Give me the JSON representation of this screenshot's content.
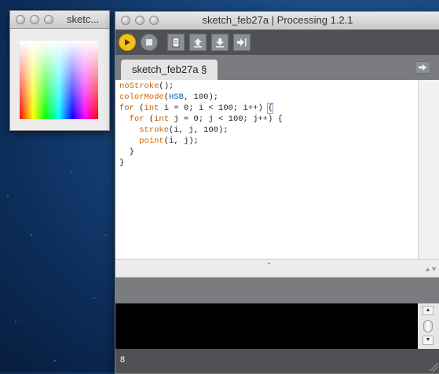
{
  "sketch_window": {
    "title": "sketc..."
  },
  "main_window": {
    "title": "sketch_feb27a | Processing 1.2.1"
  },
  "toolbar": {
    "run_icon": "play-icon",
    "stop_icon": "stop-icon",
    "new_icon": "document-icon",
    "open_icon": "arrow-up-icon",
    "save_icon": "arrow-down-icon",
    "export_icon": "arrow-right-icon"
  },
  "tabs": [
    {
      "label": "sketch_feb27a §"
    }
  ],
  "editor": {
    "lines": [
      [
        "",
        "noStroke",
        "();"
      ],
      [
        "",
        "colorMode",
        "(",
        "HSB",
        ", 100);"
      ],
      [
        "for",
        " (",
        "int",
        " i = 0; i < 100; i++) ",
        "{"
      ],
      [
        "  for",
        " (",
        "int",
        " j = 0; j < 100; j++) {"
      ],
      [
        "    ",
        "stroke",
        "(i, j, 100);"
      ],
      [
        "    ",
        "point",
        "(i, j);"
      ],
      [
        "  }"
      ],
      [
        "}"
      ]
    ]
  },
  "divider": {
    "arrow": "ˆ",
    "grip": "▲▼"
  },
  "status": {
    "line_number": "8"
  },
  "colors": {
    "run_button": "#f2c21a",
    "toolbar_bg": "#4f5154",
    "tabbar_bg": "#7a7c80",
    "keyword": "#b35c00",
    "constant": "#0066aa"
  }
}
